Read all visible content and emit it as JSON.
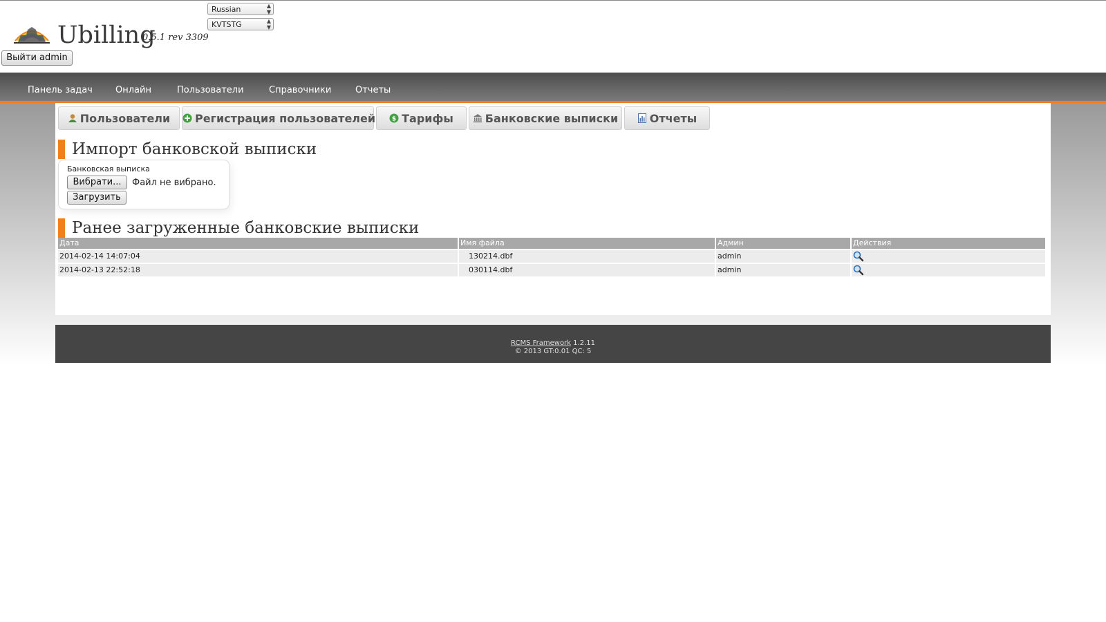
{
  "header": {
    "logo_text": "Ubilling",
    "version": "0.5.1 rev 3309",
    "language_select": "Russian",
    "skin_select": "KVTSTG",
    "logout_label": "Выйти admin"
  },
  "nav": {
    "items": [
      "Панель задач",
      "Онлайн",
      "Пользователи",
      "Справочники",
      "Отчеты"
    ]
  },
  "tabs": [
    {
      "label": "Пользователи",
      "icon": "user-icon"
    },
    {
      "label": "Регистрация пользователей",
      "icon": "add-icon"
    },
    {
      "label": "Тарифы",
      "icon": "money-icon"
    },
    {
      "label": "Банковские выписки",
      "icon": "bank-icon"
    },
    {
      "label": "Отчеты",
      "icon": "report-icon"
    }
  ],
  "import_section": {
    "title": "Импорт банковской выписки",
    "legend": "Банковская выписка",
    "choose_label": "Вибрати...",
    "file_status": "Файл не вибрано.",
    "upload_label": "Загрузить"
  },
  "history_section": {
    "title": "Ранее загруженные банковские выписки",
    "columns": [
      "Дата",
      "Имя файла",
      "Админ",
      "Действия"
    ],
    "rows": [
      {
        "date": "2014-02-14 14:07:04",
        "filename": "130214.dbf",
        "admin": "admin"
      },
      {
        "date": "2014-02-13 22:52:18",
        "filename": "030114.dbf",
        "admin": "admin"
      }
    ]
  },
  "footer": {
    "framework_link": "RCMS Framework",
    "framework_version": "1.2.11",
    "stats": "© 2013 GT:0.01 QC: 5"
  },
  "colors": {
    "accent": "#f0811a",
    "nav_bg": "#5a5a5a",
    "footer_bg": "#454545",
    "table_header": "#a8a8a8"
  }
}
